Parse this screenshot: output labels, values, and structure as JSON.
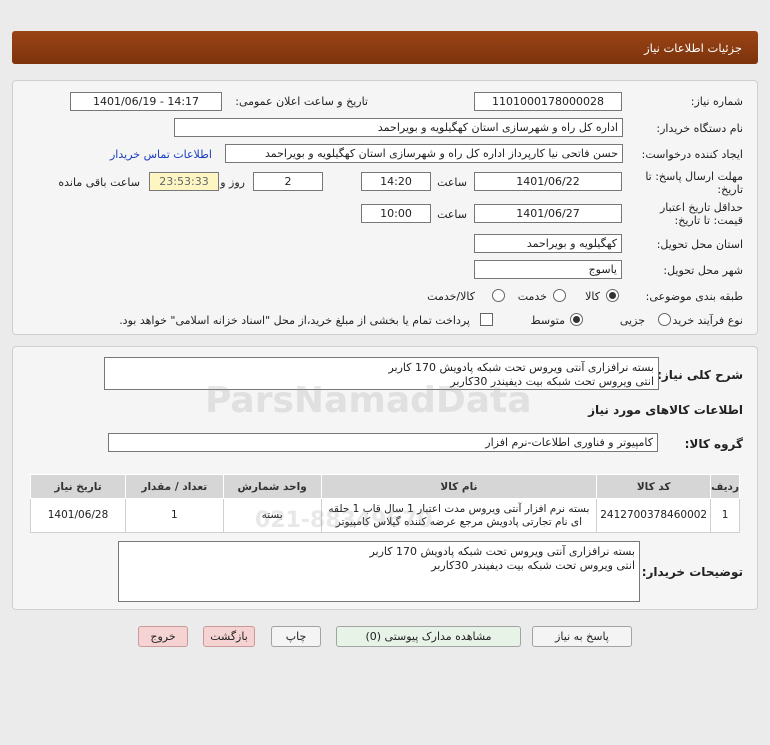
{
  "header": {
    "title": "جزئیات اطلاعات نیاز"
  },
  "fields": {
    "need_number_label": "شماره نیاز:",
    "need_number": "1101000178000028",
    "announce_label": "تاریخ و ساعت اعلان عمومی:",
    "announce_value": "1401/06/19 - 14:17",
    "buyer_org_label": "نام دستگاه خریدار:",
    "buyer_org": "اداره کل راه و شهرسازی استان کهگیلویه و بویراحمد",
    "creator_label": "ایجاد کننده درخواست:",
    "creator": "حسن فاتحی نیا کارپرداز اداره کل راه و شهرسازی استان کهگیلویه و بویراحمد",
    "contact_link": "اطلاعات تماس خریدار",
    "reply_deadline_label_1": "مهلت ارسال پاسخ: تا",
    "reply_deadline_label_2": "تاریخ:",
    "reply_date": "1401/06/22",
    "time_label": "ساعت",
    "reply_time": "14:20",
    "days_value": "2",
    "days_label": "روز و",
    "remaining_time": "23:53:33",
    "remaining_label": "ساعت باقی مانده",
    "validity_label_1": "حداقل تاریخ اعتبار",
    "validity_label_2": "قیمت: تا تاریخ:",
    "validity_date": "1401/06/27",
    "validity_time_label": "ساعت",
    "validity_time": "10:00",
    "delivery_place_label": "استان محل تحویل:",
    "delivery_place": "کهگیلویه و بویراحمد",
    "delivery_city_label": "شهر محل تحویل:",
    "delivery_city": "یاسوج",
    "category_label": "طبقه بندی موضوعی:",
    "category_options": [
      "کالا",
      "خدمت",
      "کالا/خدمت"
    ],
    "process_label": "نوع فرآیند خرید :",
    "process_options": [
      "جزیی",
      "متوسط"
    ],
    "payment_note": "پرداخت تمام یا بخشی از مبلغ خرید،از محل \"اسناد خزانه اسلامی\" خواهد بود."
  },
  "summary": {
    "label": "شرح کلی نیاز:",
    "line1": "بسته نرافزاری آنتی ویروس تحت شبکه پادویش 170 کاربر",
    "line2": "انتی ویروس تحت شبکه بیت دیفیندر 30کاربر"
  },
  "goods_section_title": "اطلاعات کالاهای مورد نیاز",
  "goods_group_label": "گروه کالا:",
  "goods_group": "کامپیوتر و فناوری اطلاعات-نرم افزار",
  "table": {
    "headers": [
      "ردیف",
      "کد کالا",
      "نام کالا",
      "واحد شمارش",
      "تعداد / مقدار",
      "تاریخ نیاز"
    ],
    "rows": [
      {
        "index": "1",
        "code": "2412700378460002",
        "name_line1": "بسته نرم افزار آنتی ویروس مدت اعتبار 1 سال قاب 1 حلقه",
        "name_line2": "ای نام تجارتی پادویش مرجع عرضه کننده گیلاس کامپیوتر",
        "unit": "بسته",
        "qty": "1",
        "date": "1401/06/28"
      }
    ]
  },
  "buyer_notes": {
    "label": "توضیحات خریدار:",
    "line1": "بسته نرافزاری آنتی ویروس تحت شبکه پادویش 170 کاربر",
    "line2": "انتی ویروس تحت شبکه بیت دیفیندر 30کاربر"
  },
  "buttons": {
    "reply": "پاسخ به نیاز",
    "attachments": "مشاهده مدارک پیوستی (0)",
    "print": "چاپ",
    "back": "بازگشت",
    "exit": "خروج"
  },
  "watermark": {
    "brand": "ParsNamadData",
    "phone": "021-88349670"
  }
}
